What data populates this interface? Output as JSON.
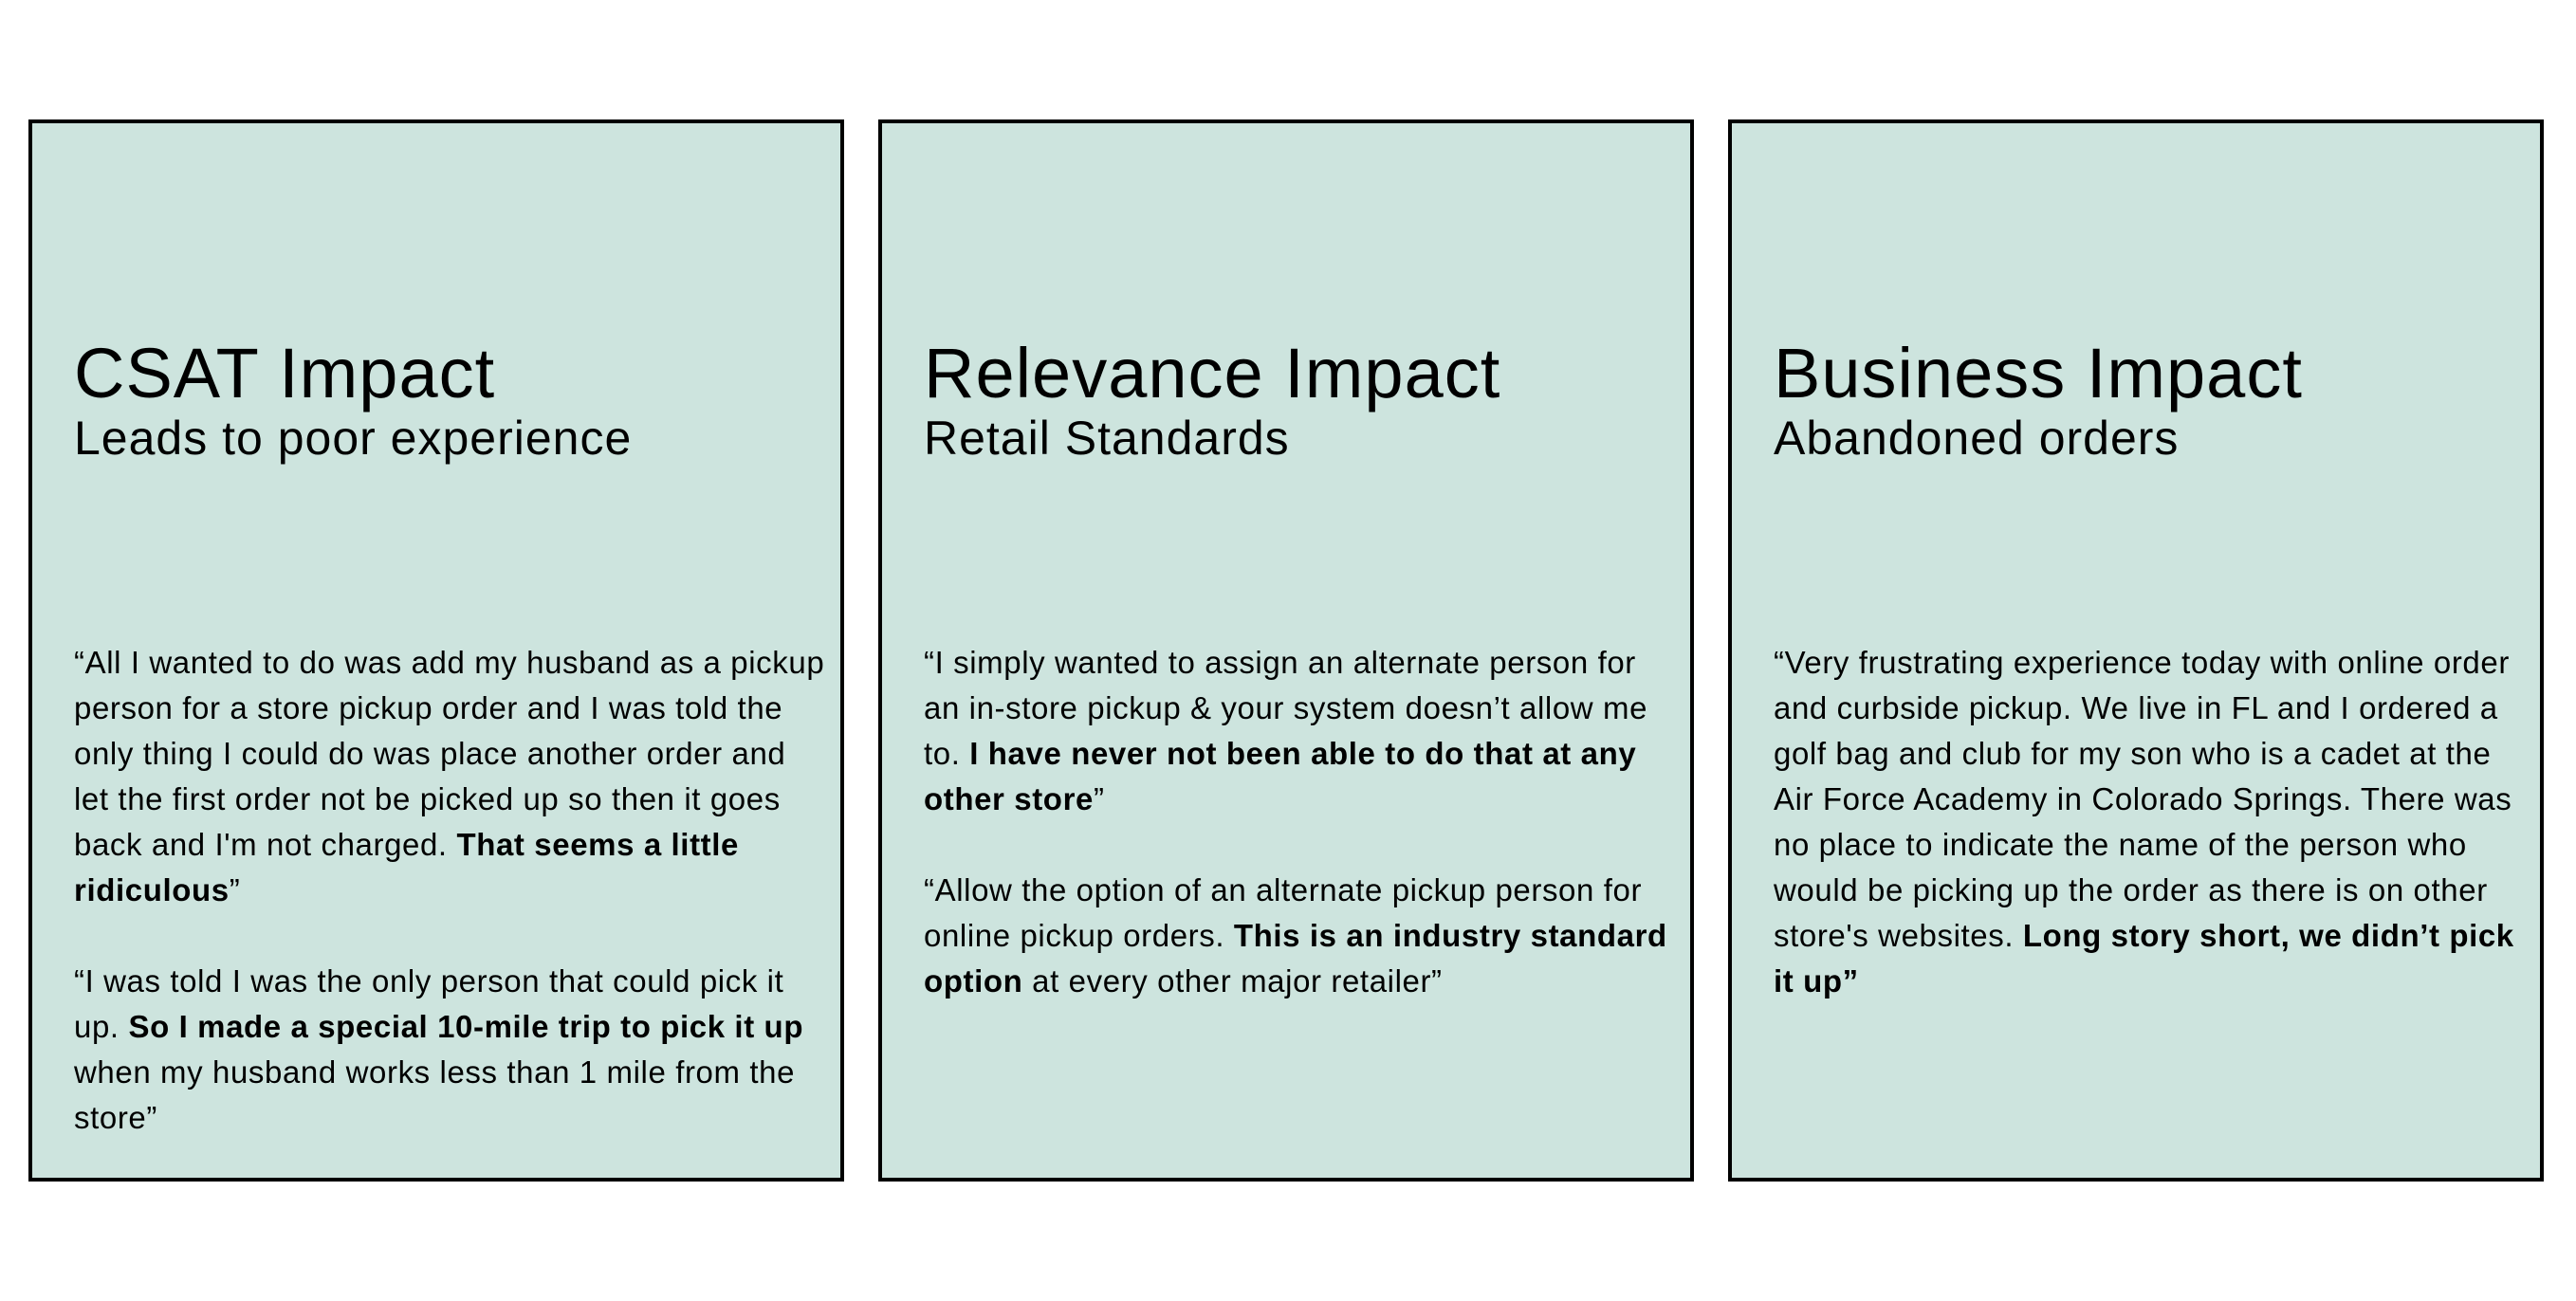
{
  "cards": [
    {
      "title": "CSAT Impact",
      "subtitle": "Leads to poor experience",
      "quotes": [
        {
          "parts": [
            {
              "text": "“All I wanted to do was add my husband as a pickup person for a store pickup order and I was told the only thing I could do was place another order and let the first order not be picked up so then it goes back and I'm not charged. ",
              "bold": false
            },
            {
              "text": "That seems a little ridiculous",
              "bold": true
            },
            {
              "text": "”",
              "bold": false
            }
          ]
        },
        {
          "parts": [
            {
              "text": "“I was told I was the only person that could pick it up. ",
              "bold": false
            },
            {
              "text": "So I made a special 10-mile trip to pick it up",
              "bold": true
            },
            {
              "text": " when my husband works less than 1 mile from the store”",
              "bold": false
            }
          ]
        }
      ]
    },
    {
      "title": "Relevance Impact",
      "subtitle": "Retail Standards",
      "quotes": [
        {
          "parts": [
            {
              "text": "“I simply wanted to assign an alternate person for an in-store pickup & your system doesn’t allow me to.  ",
              "bold": false
            },
            {
              "text": "I have never not been able to do that at any other store",
              "bold": true
            },
            {
              "text": "”",
              "bold": false
            }
          ]
        },
        {
          "parts": [
            {
              "text": "“Allow the option of an alternate pickup person for online pickup orders. ",
              "bold": false
            },
            {
              "text": "This is an industry standard option",
              "bold": true
            },
            {
              "text": " at every other major retailer”",
              "bold": false
            }
          ]
        }
      ]
    },
    {
      "title": "Business Impact",
      "subtitle": "Abandoned orders",
      "quotes": [
        {
          "parts": [
            {
              "text": "“Very frustrating experience today with online order and curbside pickup. We live in FL and I ordered a golf bag and club for my son who is a cadet at the Air Force Academy in Colorado Springs. There was no place to indicate the name of the person who would be picking up the order as there is on other store's websites. ",
              "bold": false
            },
            {
              "text": "Long story short, we didn’t pick it up”",
              "bold": true
            }
          ]
        }
      ]
    }
  ]
}
